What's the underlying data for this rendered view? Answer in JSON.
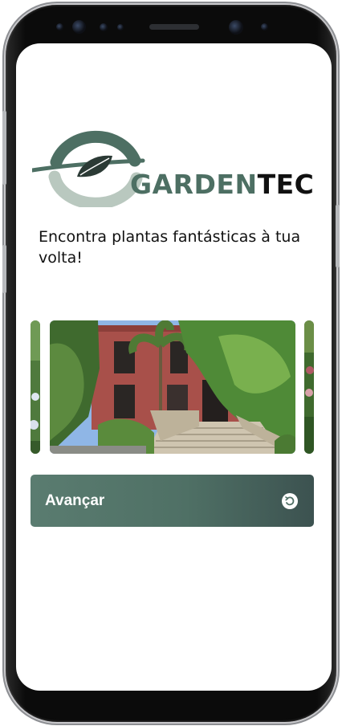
{
  "app": {
    "brand_part1": "GARDEN",
    "brand_part2": "TEC",
    "headline": "Encontra plantas fantásticas à tua volta!"
  },
  "carousel": {
    "slides": [
      {
        "name": "previous-slide",
        "subject": "garden-flowers"
      },
      {
        "name": "current-slide",
        "subject": "red-building-with-stairs-and-trees"
      },
      {
        "name": "next-slide",
        "subject": "garden-plants"
      }
    ]
  },
  "actions": {
    "advance_label": "Avançar",
    "advance_icon": "arrow-circle-icon"
  },
  "colors": {
    "brand_green": "#4d6f63",
    "brand_light_green": "#b9c8bf",
    "button_start": "#5a7c70",
    "button_end": "#3c5250",
    "text_dark": "#111111"
  }
}
